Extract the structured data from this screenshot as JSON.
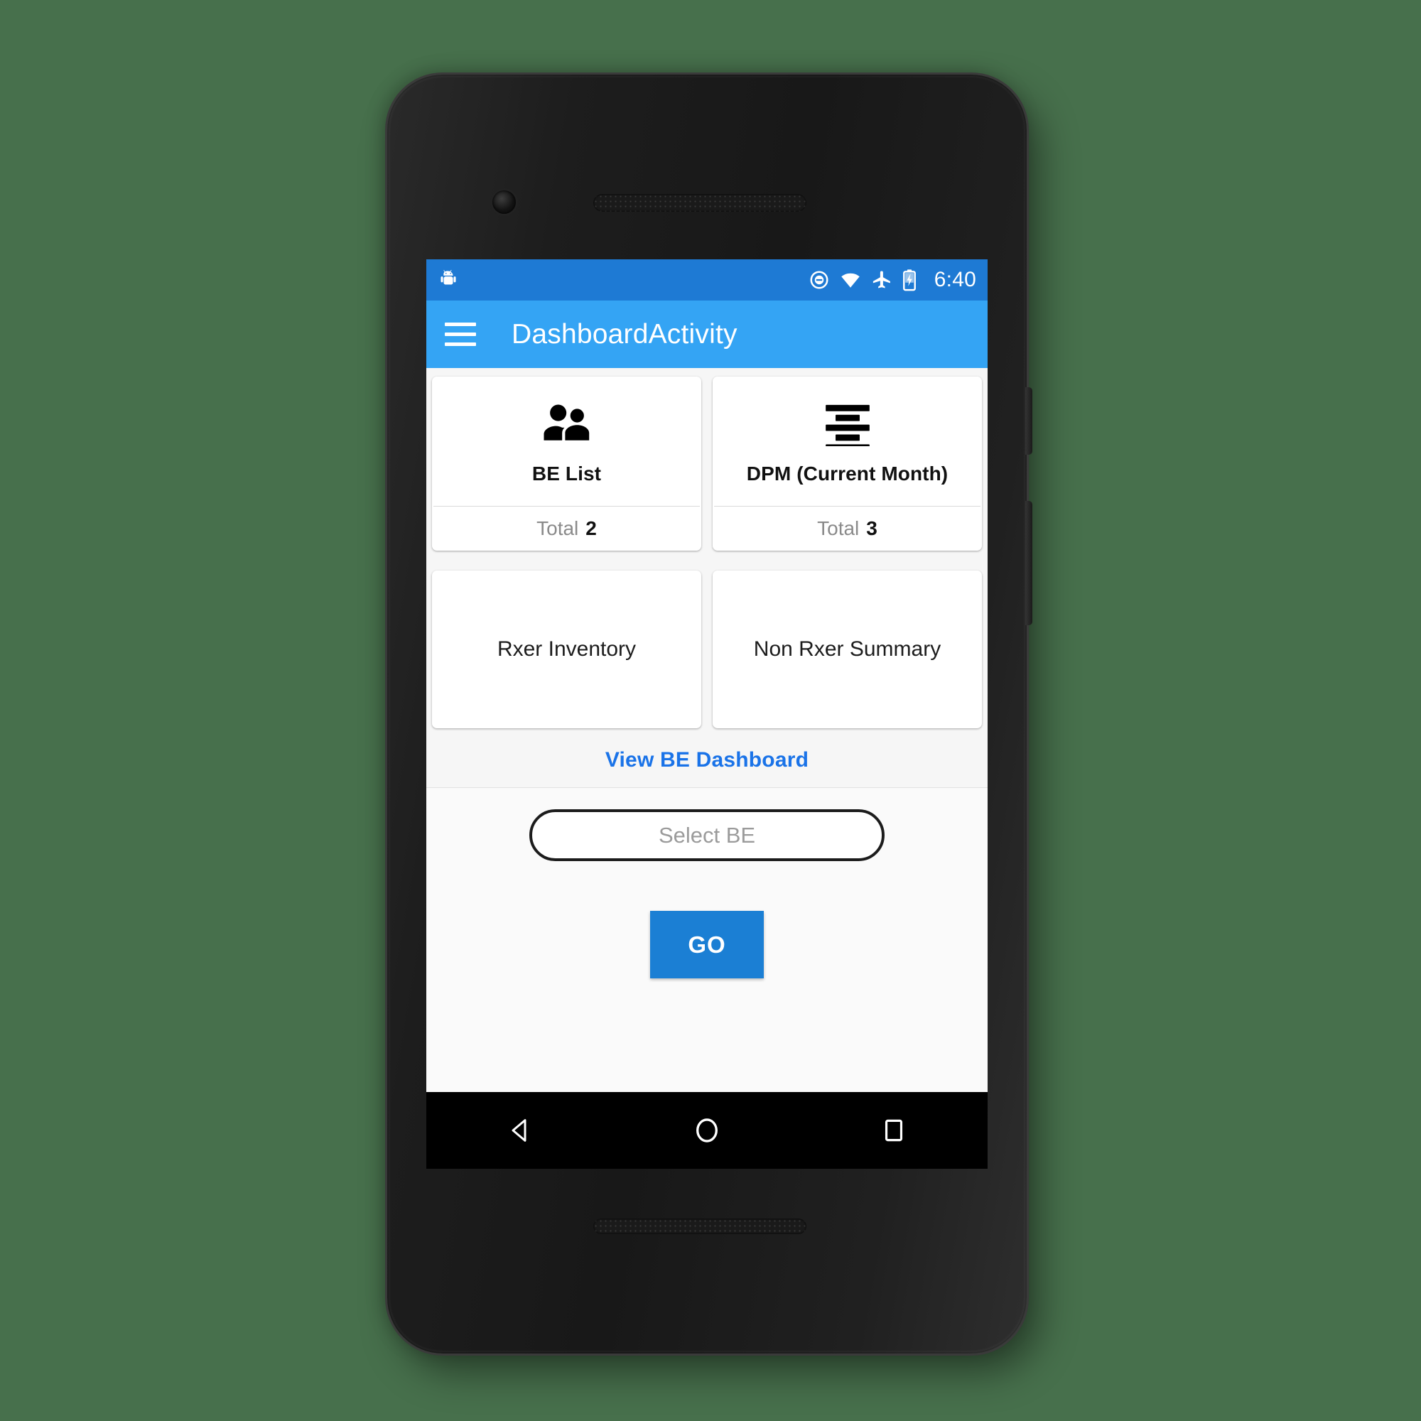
{
  "theme": {
    "page_background": "#47704c",
    "status_bar_color": "#1e7ad4",
    "app_bar_color": "#34a4f4",
    "accent_blue": "#1b7fd4",
    "link_blue": "#1a73e8",
    "content_background": "#f6f6f6",
    "card_background": "#ffffff"
  },
  "status_bar": {
    "mascot_icon": "android-mascot-icon",
    "icons": [
      "do-not-disturb-icon",
      "wifi-icon",
      "airplane-mode-icon",
      "battery-charging-icon"
    ],
    "time": "6:40"
  },
  "app_bar": {
    "menu_icon": "hamburger-menu-icon",
    "title": "DashboardActivity"
  },
  "dashboard": {
    "cards_top": [
      {
        "id": "be-list",
        "icon": "people-icon",
        "title": "BE List",
        "total_label": "Total",
        "total_value": "2"
      },
      {
        "id": "dpm",
        "icon": "format-align-icon",
        "title": "DPM (Current Month)",
        "total_label": "Total",
        "total_value": "3"
      }
    ],
    "cards_bottom": [
      {
        "id": "rxer-inventory",
        "label": "Rxer Inventory"
      },
      {
        "id": "non-rxer-summary",
        "label": "Non Rxer Summary"
      }
    ],
    "view_dashboard_link": "View BE Dashboard"
  },
  "form": {
    "select_be": {
      "value": "",
      "placeholder": "Select BE"
    },
    "go_button_label": "GO"
  },
  "nav_bar": {
    "back_icon": "back-triangle-icon",
    "home_icon": "home-circle-icon",
    "recents_icon": "recents-square-icon"
  }
}
